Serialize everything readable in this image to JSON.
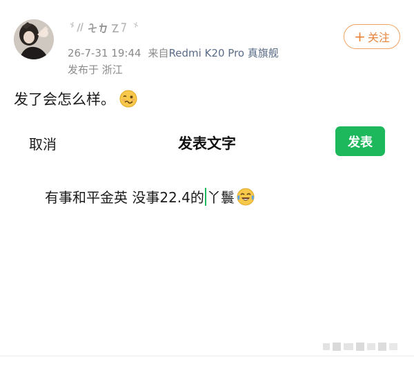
{
  "post": {
    "username": "*/ 妖 2! *",
    "timestamp": "26-7-31 19:44",
    "source_prefix": "来自",
    "device": "Redmi K20 Pro 真旗舰",
    "location": "发布于 浙江",
    "follow_label": "关注",
    "follow_icon": "plus-icon",
    "text": "发了会怎么样。",
    "emoji": "woozy-face-icon"
  },
  "compose": {
    "cancel_label": "取消",
    "title": "发表文字",
    "publish_label": "发表",
    "text_before_caret": "有事和平金英 没事22.4的",
    "text_after_caret": "丫鬟",
    "emoji": "face-with-tears-of-joy-icon"
  },
  "colors": {
    "accent_orange": "#e8843a",
    "publish_green": "#1db85b",
    "meta_gray": "#8a8a8a",
    "device_blue": "#5a6b86"
  }
}
